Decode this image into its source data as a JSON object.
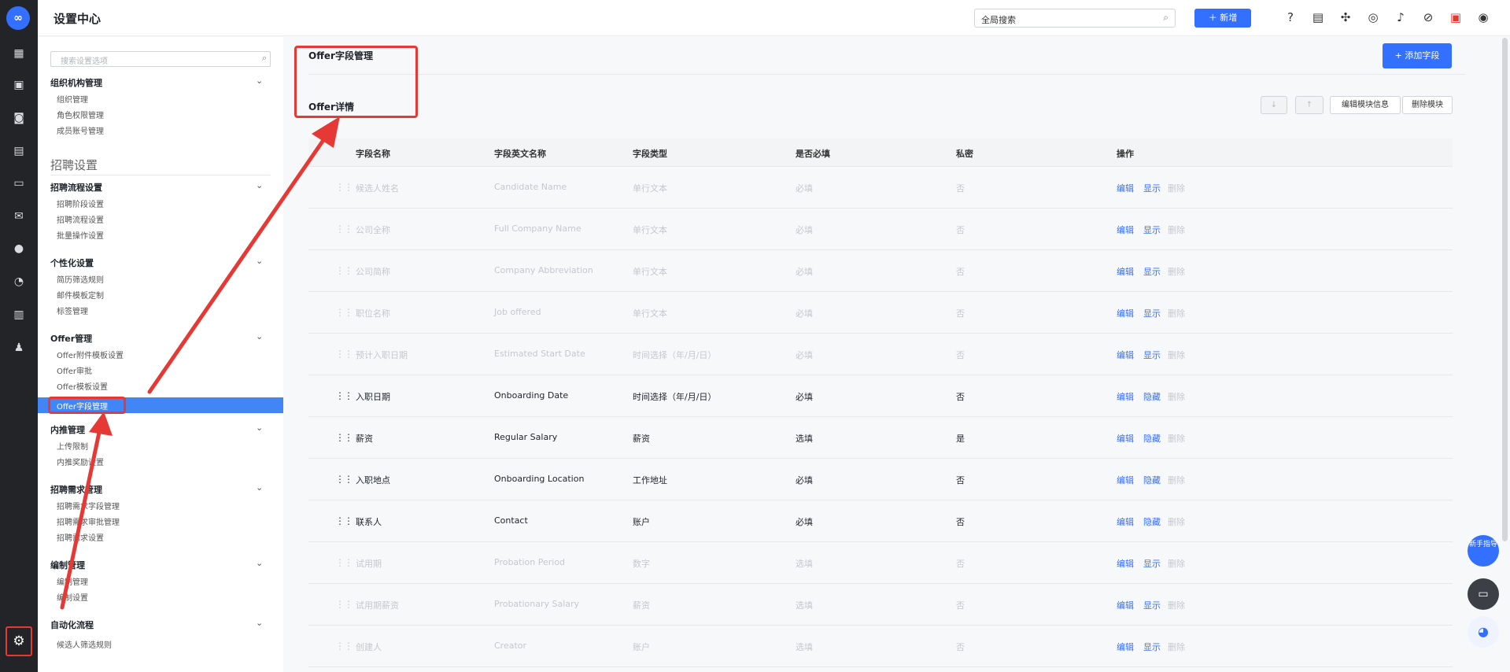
{
  "header": {
    "title": "设置中心",
    "search_placeholder": "全局搜索",
    "new_label": "新增",
    "new_icon": "plus-icon",
    "icons": [
      "help-icon",
      "document-icon",
      "puzzle-icon",
      "location-icon",
      "bell-icon",
      "compass-icon",
      "gift-icon",
      "user-icon"
    ]
  },
  "rail": {
    "icons": [
      "dashboard-icon",
      "briefcase-icon",
      "candidate-icon",
      "calendar-icon",
      "contact-card-icon",
      "chat-icon",
      "fire-icon",
      "pie-chart-icon",
      "bar-chart-icon",
      "team-icon",
      "settings-icon"
    ]
  },
  "nav": {
    "search_placeholder": "搜索设置选项",
    "section_title": "招聘设置",
    "groups": [
      {
        "title": "组织机构管理",
        "items": [
          "组织管理",
          "角色权限管理",
          "成员账号管理"
        ]
      },
      {
        "title": "招聘流程设置",
        "items": [
          "招聘阶段设置",
          "招聘流程设置",
          "批量操作设置"
        ]
      },
      {
        "title": "个性化设置",
        "items": [
          "简历筛选规则",
          "邮件模板定制",
          "标签管理"
        ]
      },
      {
        "title": "Offer管理",
        "items": [
          "Offer附件模板设置",
          "Offer审批",
          "Offer模板设置",
          "Offer字段管理"
        ]
      },
      {
        "title": "内推管理",
        "items": [
          "上传限制",
          "内推奖励设置"
        ]
      },
      {
        "title": "招聘需求管理",
        "items": [
          "招聘需求字段管理",
          "招聘需求审批管理",
          "招聘需求设置"
        ]
      },
      {
        "title": "编制管理",
        "items": [
          "编制管理",
          "编制设置"
        ]
      },
      {
        "title": "自动化流程",
        "items": [
          "候选人筛选规则"
        ]
      }
    ]
  },
  "content": {
    "page_title": "Offer字段管理",
    "add_field": "+ 添加字段",
    "module_title": "Offer详情",
    "module_buttons": {
      "down": "↓",
      "up": "↑",
      "edit": "编辑模块信息",
      "delete": "删除模块"
    },
    "columns": [
      "字段名称",
      "字段英文名称",
      "字段类型",
      "是否必填",
      "私密",
      "操作"
    ],
    "rows": [
      {
        "name": "候选人姓名",
        "en": "Candidate Name",
        "type": "单行文本",
        "required": "必填",
        "private": "否",
        "a1": "编辑",
        "a2": "显示",
        "a3": "删除",
        "enabled": false
      },
      {
        "name": "公司全称",
        "en": "Full Company Name",
        "type": "单行文本",
        "required": "必填",
        "private": "否",
        "a1": "编辑",
        "a2": "显示",
        "a3": "删除",
        "enabled": false
      },
      {
        "name": "公司简称",
        "en": "Company Abbreviation",
        "type": "单行文本",
        "required": "必填",
        "private": "否",
        "a1": "编辑",
        "a2": "显示",
        "a3": "删除",
        "enabled": false
      },
      {
        "name": "职位名称",
        "en": "Job offered",
        "type": "单行文本",
        "required": "必填",
        "private": "否",
        "a1": "编辑",
        "a2": "显示",
        "a3": "删除",
        "enabled": false
      },
      {
        "name": "预计入职日期",
        "en": "Estimated Start Date",
        "type": "时间选择（年/月/日）",
        "required": "必填",
        "private": "否",
        "a1": "编辑",
        "a2": "显示",
        "a3": "删除",
        "enabled": false
      },
      {
        "name": "入职日期",
        "en": "Onboarding Date",
        "type": "时间选择（年/月/日）",
        "required": "必填",
        "private": "否",
        "a1": "编辑",
        "a2": "隐藏",
        "a3": "删除",
        "enabled": true
      },
      {
        "name": "薪资",
        "en": "Regular Salary",
        "type": "薪资",
        "required": "选填",
        "private": "是",
        "a1": "编辑",
        "a2": "隐藏",
        "a3": "删除",
        "enabled": true
      },
      {
        "name": "入职地点",
        "en": "Onboarding Location",
        "type": "工作地址",
        "required": "必填",
        "private": "否",
        "a1": "编辑",
        "a2": "隐藏",
        "a3": "删除",
        "enabled": true
      },
      {
        "name": "联系人",
        "en": "Contact",
        "type": "账户",
        "required": "必填",
        "private": "否",
        "a1": "编辑",
        "a2": "隐藏",
        "a3": "删除",
        "enabled": true
      },
      {
        "name": "试用期",
        "en": "Probation Period",
        "type": "数字",
        "required": "选填",
        "private": "否",
        "a1": "编辑",
        "a2": "显示",
        "a3": "删除",
        "enabled": false
      },
      {
        "name": "试用期薪资",
        "en": "Probationary Salary",
        "type": "薪资",
        "required": "选填",
        "private": "否",
        "a1": "编辑",
        "a2": "显示",
        "a3": "删除",
        "enabled": false
      },
      {
        "name": "创建人",
        "en": "Creator",
        "type": "账户",
        "required": "选填",
        "private": "否",
        "a1": "编辑",
        "a2": "显示",
        "a3": "删除",
        "enabled": false
      }
    ]
  },
  "floating": {
    "guide": "新手指导",
    "chat_icon": "chat-bubble-icon",
    "bot_icon": "assistant-bot-icon"
  },
  "colors": {
    "accent": "#3370ff",
    "annotation_red": "#e53935",
    "rail_bg": "#222427",
    "active_nav": "#4285f4"
  }
}
